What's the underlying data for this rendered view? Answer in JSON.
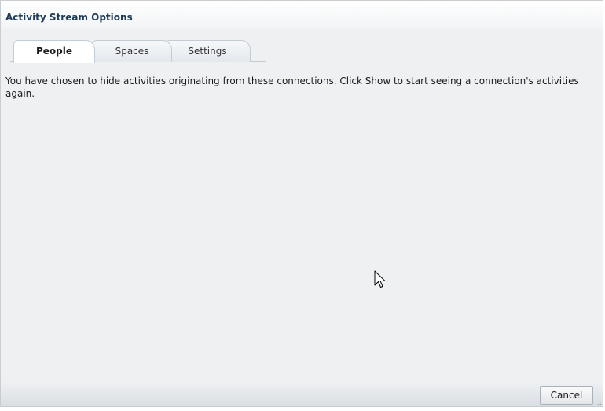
{
  "dialog": {
    "title": "Activity Stream Options",
    "tabs": [
      {
        "label": "People",
        "selected": true
      },
      {
        "label": "Spaces",
        "selected": false
      },
      {
        "label": "Settings",
        "selected": false
      }
    ],
    "message": "You have chosen to hide activities originating from these connections. Click Show to start seeing a connection's activities again.",
    "cancel_label": "Cancel"
  },
  "colors": {
    "title": "#1f3b57",
    "panel_background": "#eef0f2",
    "tab_border": "#c3cbd4"
  },
  "icons": {
    "cursor": "mouse-pointer-icon",
    "resize": "resize-grip-icon"
  }
}
